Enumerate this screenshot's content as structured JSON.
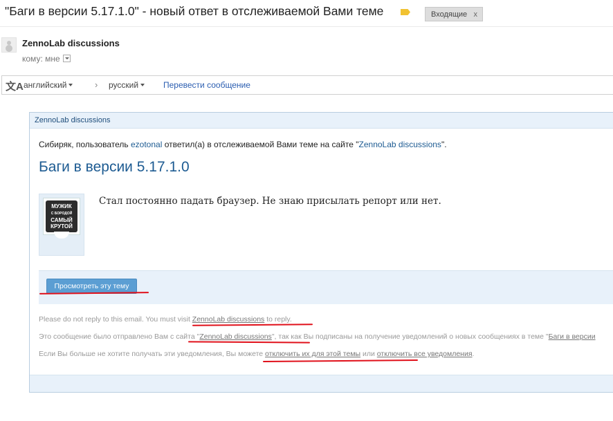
{
  "email": {
    "subject": "\"Баги в версии 5.17.1.0\" - новый ответ в отслеживаемой Вами теме",
    "label_chip": "Входящие",
    "label_chip_close": "x",
    "sender": "ZennoLab discussions",
    "to_text": "кому: мне"
  },
  "translate": {
    "icon": "文A",
    "from_lang": "английский",
    "arrow": "›",
    "to_lang": "русский",
    "link": "Перевести сообщение"
  },
  "card": {
    "header": "ZennoLab discussions",
    "intro_before": "Сибиряк, пользователь ",
    "intro_user": "ezotonal",
    "intro_middle": " ответил(а) в отслеживаемой Вами теме на сайте \"",
    "intro_site": "ZennoLab discussions",
    "intro_after": "\".",
    "thread_title": "Баги в версии 5.17.1.0",
    "avatar_text_top": "МУЖИК",
    "avatar_text_small": "С БОРОДОЙ",
    "avatar_text_mid": "САМЫЙ",
    "avatar_text_bottom": "КРУТОЙ",
    "post_text": "Стал постоянно падать браузер. Не знаю присылать репорт или нет.",
    "view_button": "Просмотреть эту тему",
    "footer1_before": "Please do not reply to this email. You must visit ",
    "footer1_link": "ZennoLab discussions",
    "footer1_after": " to reply.",
    "footer2_before": "Это сообщение было отправлено Вам с сайта \"",
    "footer2_link": "ZennoLab discussions",
    "footer2_middle": "\", так как Вы подписаны на получение уведомлений о новых сообщениях в теме \"",
    "footer2_link2": "Баги в версии",
    "footer3_before": "Если Вы больше не хотите получать эти уведомления, Вы можете ",
    "footer3_link1": "отключить их для этой темы",
    "footer3_middle": " или ",
    "footer3_link2": "отключить все уведомления",
    "footer3_after": "."
  },
  "colors": {
    "accent": "#1d5b92",
    "button": "#5b9ed3",
    "annotation": "#e0101a",
    "label_tag": "#f1c232"
  }
}
